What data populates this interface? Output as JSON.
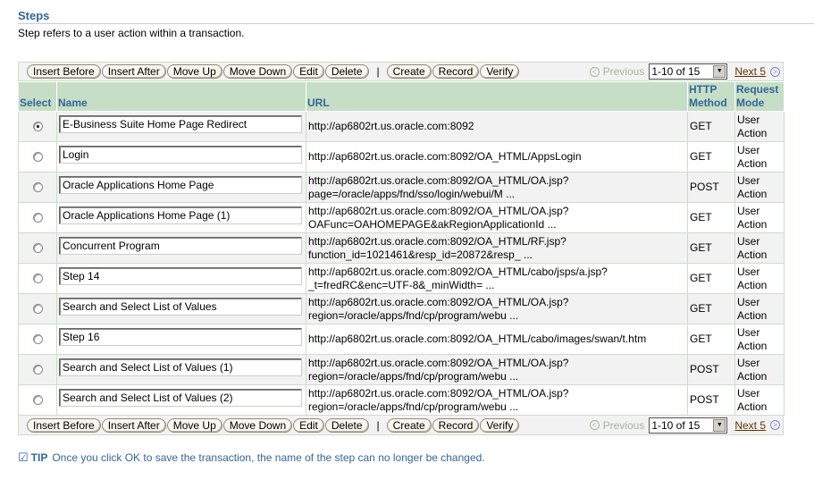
{
  "header": {
    "title": "Steps",
    "description": "Step refers to a user action within a transaction."
  },
  "toolbar": {
    "insert_before": "Insert Before",
    "insert_after": "Insert After",
    "move_up": "Move Up",
    "move_down": "Move Down",
    "edit": "Edit",
    "delete": "Delete",
    "separator": "|",
    "create": "Create",
    "record": "Record",
    "verify": "Verify",
    "previous": "Previous",
    "range": "1-10 of 15",
    "next": "Next 5"
  },
  "table": {
    "columns": [
      "Select",
      "Name",
      "URL",
      "HTTP Method",
      "Request Mode"
    ],
    "column_lines": {
      "http_method": [
        "HTTP",
        "Method"
      ],
      "request_mode": [
        "Request",
        "Mode"
      ]
    },
    "rows": [
      {
        "selected": true,
        "name": "E-Business Suite Home Page Redirect",
        "url1": "http://ap6802rt.us.oracle.com:8092",
        "url2": "",
        "method": "GET",
        "mode1": "User",
        "mode2": "Action"
      },
      {
        "selected": false,
        "name": "Login",
        "url1": "http://ap6802rt.us.oracle.com:8092/OA_HTML/AppsLogin",
        "url2": "",
        "method": "GET",
        "mode1": "User",
        "mode2": "Action"
      },
      {
        "selected": false,
        "name": "Oracle Applications Home Page",
        "url1": "http://ap6802rt.us.oracle.com:8092/OA_HTML/OA.jsp?",
        "url2": "page=/oracle/apps/fnd/sso/login/webui/M ...",
        "method": "POST",
        "mode1": "User",
        "mode2": "Action"
      },
      {
        "selected": false,
        "name": "Oracle Applications Home Page (1)",
        "url1": "http://ap6802rt.us.oracle.com:8092/OA_HTML/OA.jsp?",
        "url2": "OAFunc=OAHOMEPAGE&akRegionApplicationId ...",
        "method": "GET",
        "mode1": "User",
        "mode2": "Action"
      },
      {
        "selected": false,
        "name": "Concurrent Program",
        "url1": "http://ap6802rt.us.oracle.com:8092/OA_HTML/RF.jsp?",
        "url2": "function_id=1021461&resp_id=20872&resp_ ...",
        "method": "GET",
        "mode1": "User",
        "mode2": "Action"
      },
      {
        "selected": false,
        "name": "Step 14",
        "url1": "http://ap6802rt.us.oracle.com:8092/OA_HTML/cabo/jsps/a.jsp?",
        "url2": "_t=fredRC&enc=UTF-8&_minWidth= ...",
        "method": "GET",
        "mode1": "User",
        "mode2": "Action"
      },
      {
        "selected": false,
        "name": "Search and Select List of Values",
        "url1": "http://ap6802rt.us.oracle.com:8092/OA_HTML/OA.jsp?",
        "url2": "region=/oracle/apps/fnd/cp/program/webu ...",
        "method": "GET",
        "mode1": "User",
        "mode2": "Action"
      },
      {
        "selected": false,
        "name": "Step 16",
        "url1": "http://ap6802rt.us.oracle.com:8092/OA_HTML/cabo/images/swan/t.htm",
        "url2": "",
        "method": "GET",
        "mode1": "User",
        "mode2": "Action"
      },
      {
        "selected": false,
        "name": "Search and Select List of Values (1)",
        "url1": "http://ap6802rt.us.oracle.com:8092/OA_HTML/OA.jsp?",
        "url2": "region=/oracle/apps/fnd/cp/program/webu ...",
        "method": "POST",
        "mode1": "User",
        "mode2": "Action"
      },
      {
        "selected": false,
        "name": "Search and Select List of Values (2)",
        "url1": "http://ap6802rt.us.oracle.com:8092/OA_HTML/OA.jsp?",
        "url2": "region=/oracle/apps/fnd/cp/program/webu ...",
        "method": "POST",
        "mode1": "User",
        "mode2": "Action"
      }
    ]
  },
  "tip": {
    "icon": "checkmark-icon",
    "label": "TIP",
    "text": "Once you click OK to save the transaction, the name of the step can no longer be changed."
  },
  "colors": {
    "header_text": "#336699",
    "header_bg": "#c6dec6",
    "link_next": "#663300",
    "disabled": "#a6b69f"
  }
}
